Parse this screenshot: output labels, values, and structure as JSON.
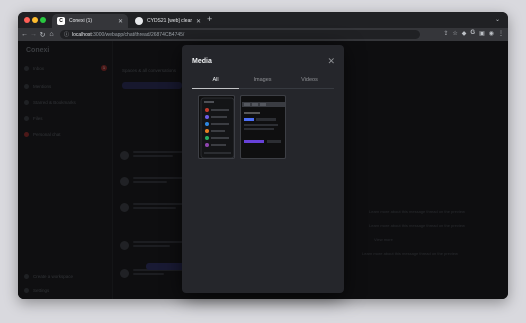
{
  "browser": {
    "tabs": [
      {
        "title": "Conexi (1)",
        "favicon": "C",
        "active": true
      },
      {
        "title": "CYDS21 [web] clean up th...",
        "favicon": "github-icon",
        "active": false
      }
    ],
    "new_tab": "+",
    "url_host": "localhost",
    "url_path": ":3000/webapp/chat/thread/26874CB4745/",
    "traffic_colors": [
      "#ff5f57",
      "#febc2e",
      "#28c840"
    ]
  },
  "app": {
    "brand": "Conexi",
    "sidebar_items": [
      {
        "label": "Inbox",
        "badge": "1"
      },
      {
        "label": "Mentions"
      },
      {
        "label": "Starred & Bookmarks"
      },
      {
        "label": "Files"
      },
      {
        "label": "Personal chat"
      }
    ],
    "sidebar_bottom": [
      {
        "label": "Create a workspace"
      },
      {
        "label": "Settings"
      }
    ],
    "header_text": "Spaces & all conversations",
    "right_panel_lines": [
      "Learn more about this message thread on the preview",
      "Learn more about this message thread on the preview",
      "View more",
      "Learn more about this message thread on the preview"
    ]
  },
  "modal": {
    "title": "Media",
    "close_icon": "close-icon",
    "tabs": [
      {
        "label": "All",
        "active": true
      },
      {
        "label": "Images",
        "active": false
      },
      {
        "label": "Videos",
        "active": false
      }
    ],
    "items": [
      {
        "kind": "mobile-screenshot-thumbnail"
      },
      {
        "kind": "desktop-screenshot-thumbnail"
      }
    ]
  },
  "colors": {
    "accent": "#2e3160",
    "modal_bg": "#25262b",
    "app_bg": "#1a1b1e"
  }
}
